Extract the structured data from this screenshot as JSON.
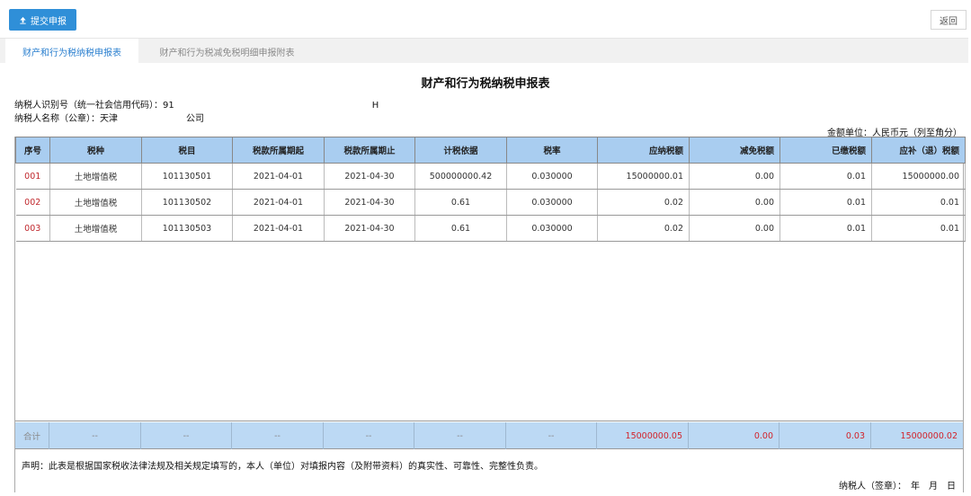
{
  "toolbar": {
    "submit_label": "提交申报",
    "back_label": "返回"
  },
  "tabs": [
    {
      "label": "财产和行为税纳税申报表",
      "active": true
    },
    {
      "label": "财产和行为税减免税明细申报附表",
      "active": false
    }
  ],
  "form": {
    "title": "财产和行为税纳税申报表",
    "taxpayer_id_label": "纳税人识别号（统一社会信用代码）：91",
    "taxpayer_id_suffix": "H",
    "taxpayer_name_label": "纳税人名称（公章）：天津",
    "taxpayer_name_suffix": "公司",
    "unit_note": "金额单位：人民币元（列至角分）",
    "statement": "声明：此表是根据国家税收法律法规及相关规定填写的，本人（单位）对填报内容（及附带资料）的真实性、可靠性、完整性负责。",
    "signature": "纳税人（签章）：　年　月　日"
  },
  "table": {
    "headers": [
      "序号",
      "税种",
      "税目",
      "税款所属期起",
      "税款所属期止",
      "计税依据",
      "税率",
      "应纳税额",
      "减免税额",
      "已缴税额",
      "应补（退）税额"
    ],
    "rows": [
      [
        "001",
        "土地增值税",
        "101130501",
        "2021-04-01",
        "2021-04-30",
        "500000000.42",
        "0.030000",
        "15000000.01",
        "0.00",
        "0.01",
        "15000000.00"
      ],
      [
        "002",
        "土地增值税",
        "101130502",
        "2021-04-01",
        "2021-04-30",
        "0.61",
        "0.030000",
        "0.02",
        "0.00",
        "0.01",
        "0.01"
      ],
      [
        "003",
        "土地增值税",
        "101130503",
        "2021-04-01",
        "2021-04-30",
        "0.61",
        "0.030000",
        "0.02",
        "0.00",
        "0.01",
        "0.01"
      ]
    ],
    "total": [
      "合计",
      "--",
      "--",
      "--",
      "--",
      "--",
      "--",
      "15000000.05",
      "0.00",
      "0.03",
      "15000000.02"
    ]
  },
  "colors": {
    "accent_blue": "#2f8fd8",
    "header_blue": "#a9cdf0",
    "total_blue": "#bcd9f4",
    "seq_red": "#c0282d",
    "total_red": "#d2232a"
  }
}
